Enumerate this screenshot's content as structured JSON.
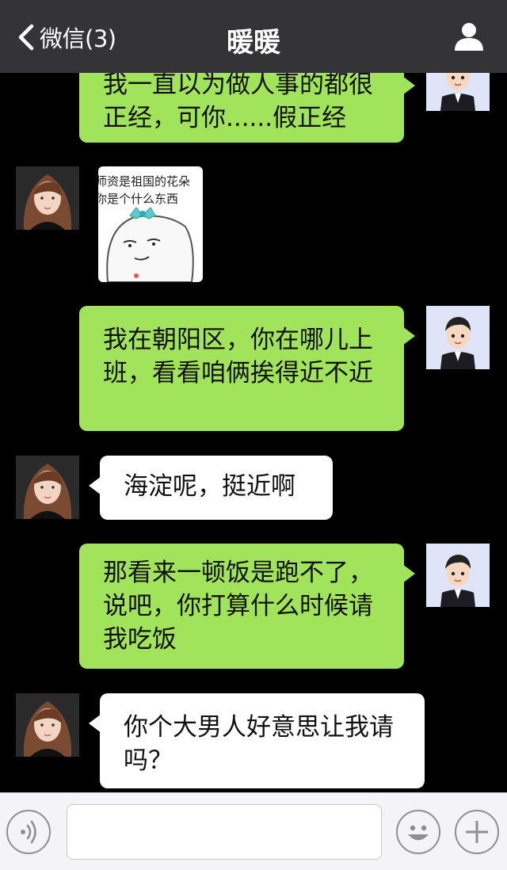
{
  "header": {
    "back_label": "微信(3)",
    "title": "暖暖"
  },
  "messages": [
    {
      "sender": "me",
      "type": "text",
      "text": "我一直以为做人事的都很\n正经，可你......假正经"
    },
    {
      "sender": "her",
      "type": "sticker",
      "lines": [
        "师资是祖国的花朵",
        "你是个什么东西"
      ]
    },
    {
      "sender": "me",
      "type": "text",
      "text": "我在朝阳区，你在哪儿上\n班，看看咱俩挨得近不近"
    },
    {
      "sender": "her",
      "type": "text",
      "text": "海淀呢，挺近啊"
    },
    {
      "sender": "me",
      "type": "text",
      "text": "那看来一顿饭是跑不了，\n说吧，你打算什么时候请\n我吃饭"
    },
    {
      "sender": "her",
      "type": "text",
      "text": "你个大男人好意思让我请\n吗？"
    }
  ],
  "input": {
    "value": "",
    "placeholder": ""
  },
  "icons": {
    "back": "chevron-left-icon",
    "profile": "person-icon",
    "voice": "voice-icon",
    "emoji": "emoji-icon",
    "add": "plus-icon"
  },
  "colors": {
    "header_bg": "#343437",
    "my_bubble": "#a1e35b",
    "her_bubble": "#ffffff",
    "chat_bg": "#000000"
  }
}
